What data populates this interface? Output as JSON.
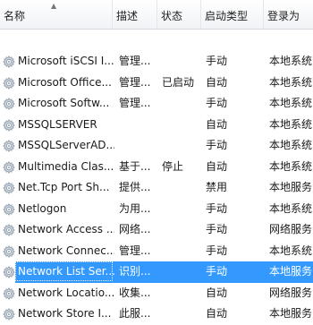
{
  "columns": {
    "name": "名称",
    "description": "描述",
    "status": "状态",
    "startup_type": "启动类型",
    "log_on_as": "登录为"
  },
  "sort_indicator": "▲",
  "icon": "gear-icon",
  "accent": "#3399ff",
  "rows": [
    {
      "name": "Microsoft iSCSI I...",
      "description": "管理...",
      "status": "",
      "startup_type": "手动",
      "log_on_as": "本地系统"
    },
    {
      "name": "Microsoft Office...",
      "description": "管理...",
      "status": "已启动",
      "startup_type": "自动",
      "log_on_as": "本地系统"
    },
    {
      "name": "Microsoft Softw...",
      "description": "管理...",
      "status": "",
      "startup_type": "手动",
      "log_on_as": "本地系统"
    },
    {
      "name": "MSSQLSERVER",
      "description": "",
      "status": "",
      "startup_type": "自动",
      "log_on_as": "本地系统"
    },
    {
      "name": "MSSQLServerAD...",
      "description": "",
      "status": "",
      "startup_type": "手动",
      "log_on_as": "本地系统"
    },
    {
      "name": "Multimedia Clas...",
      "description": "基于...",
      "status": "停止",
      "startup_type": "自动",
      "log_on_as": "本地系统"
    },
    {
      "name": "Net.Tcp Port Sh...",
      "description": "提供...",
      "status": "",
      "startup_type": "禁用",
      "log_on_as": "本地服务"
    },
    {
      "name": "Netlogon",
      "description": "为用...",
      "status": "",
      "startup_type": "手动",
      "log_on_as": "本地系统"
    },
    {
      "name": "Network Access ...",
      "description": "网络...",
      "status": "",
      "startup_type": "手动",
      "log_on_as": "网络服务"
    },
    {
      "name": "Network Connec...",
      "description": "管理...",
      "status": "",
      "startup_type": "手动",
      "log_on_as": "本地系统"
    },
    {
      "name": "Network List Ser...",
      "description": "识别...",
      "status": "",
      "startup_type": "手动",
      "log_on_as": "本地服务",
      "selected": true
    },
    {
      "name": "Network Locatio...",
      "description": "收集...",
      "status": "",
      "startup_type": "自动",
      "log_on_as": "网络服务"
    },
    {
      "name": "Network Store I...",
      "description": "此服...",
      "status": "",
      "startup_type": "自动",
      "log_on_as": "本地服务"
    }
  ]
}
